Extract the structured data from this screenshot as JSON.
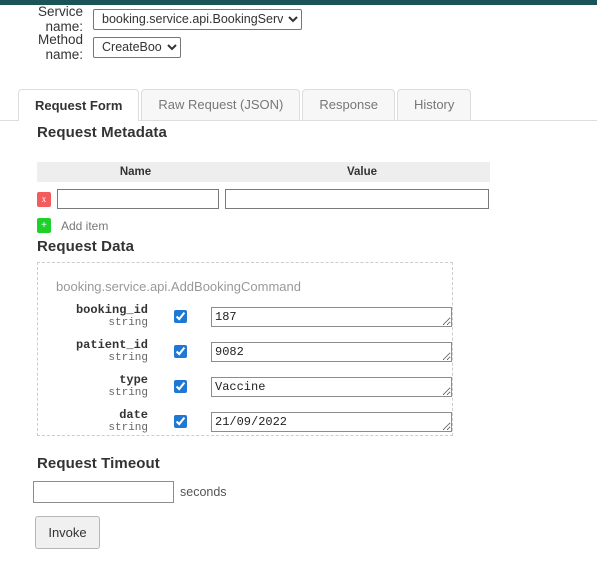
{
  "topbar": {
    "color": "#195457"
  },
  "selectors": {
    "service": {
      "label": "Service name:",
      "selected": "booking.service.api.BookingService"
    },
    "method": {
      "label": "Method name:",
      "selected": "CreateBooking"
    }
  },
  "tabs": [
    {
      "label": "Request Form",
      "active": true
    },
    {
      "label": "Raw Request (JSON)",
      "active": false
    },
    {
      "label": "Response",
      "active": false
    },
    {
      "label": "History",
      "active": false
    }
  ],
  "request_metadata": {
    "title": "Request Metadata",
    "columns": {
      "name": "Name",
      "value": "Value"
    },
    "rows": [
      {
        "delete_label": "x",
        "name": "",
        "value": ""
      }
    ],
    "add": {
      "button_label": "+",
      "label": "Add item"
    }
  },
  "request_data": {
    "title": "Request Data",
    "message_type": "booking.service.api.AddBookingCommand",
    "fields": [
      {
        "name": "booking_id",
        "type": "string",
        "checked": true,
        "value": "187"
      },
      {
        "name": "patient_id",
        "type": "string",
        "checked": true,
        "value": "9082"
      },
      {
        "name": "type",
        "type": "string",
        "checked": true,
        "value": "Vaccine"
      },
      {
        "name": "date",
        "type": "string",
        "checked": true,
        "value": "21/09/2022"
      }
    ]
  },
  "request_timeout": {
    "title": "Request Timeout",
    "value": "",
    "unit": "seconds"
  },
  "invoke_button": {
    "label": "Invoke"
  },
  "colors": {
    "accent_bar": "#195457",
    "delete_button": "#f25c5c",
    "add_button": "#1ed12a",
    "checkbox": "#1f78d1"
  }
}
